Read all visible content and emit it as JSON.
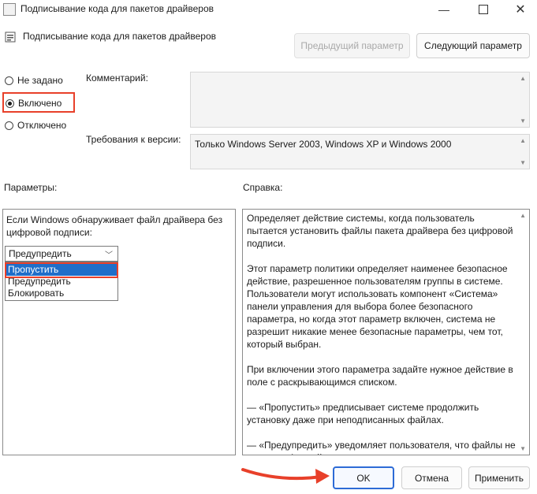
{
  "window": {
    "title": "Подписывание кода для пакетов драйверов",
    "min_icon": "—",
    "max_icon": "maximize",
    "close_icon": "✕"
  },
  "header": {
    "title": "Подписывание кода для пакетов драйверов",
    "prev_button": "Предыдущий параметр",
    "next_button": "Следующий параметр"
  },
  "state": {
    "options": [
      {
        "label": "Не задано",
        "selected": false
      },
      {
        "label": "Включено",
        "selected": true
      },
      {
        "label": "Отключено",
        "selected": false
      }
    ]
  },
  "comment": {
    "label": "Комментарий:",
    "value": ""
  },
  "supported": {
    "label": "Требования к версии:",
    "value": "Только Windows Server 2003, Windows XP и Windows 2000"
  },
  "params": {
    "label": "Параметры:",
    "description": "Если Windows обнаруживает файл драйвера без цифровой подписи:",
    "select_value": "Предупредить",
    "dropdown_items": [
      {
        "label": "Пропустить",
        "highlighted": true
      },
      {
        "label": "Предупредить",
        "highlighted": false
      },
      {
        "label": "Блокировать",
        "highlighted": false
      }
    ]
  },
  "help": {
    "label": "Справка:",
    "paragraphs": [
      "Определяет действие системы, когда пользователь пытается установить файлы пакета драйвера без цифровой подписи.",
      "Этот параметр политики определяет наименее безопасное действие, разрешенное пользователям группы в системе. Пользователи могут использовать компонент «Система» панели управления для выбора более безопасного параметра, но когда этот параметр включен, система не разрешит никакие менее безопасные параметры, чем тот, который выбран.",
      "При включении этого параметра задайте нужное действие в поле с раскрывающимся списком.",
      "— «Пропустить» предписывает системе продолжить установку даже при неподписанных файлах.",
      "— «Предупредить» уведомляет пользователя, что файлы не имеют цифровой подписи, и предоставляет пользователю возможность решить, остановить установку или продолжить, и разрешить ли установку неподписанных файлов. Параметр"
    ]
  },
  "footer": {
    "ok": "OK",
    "cancel": "Отмена",
    "apply": "Применить"
  },
  "colors": {
    "highlight": "#e8402a",
    "selection": "#1f6ec9",
    "primary_border": "#2d6bd6"
  }
}
